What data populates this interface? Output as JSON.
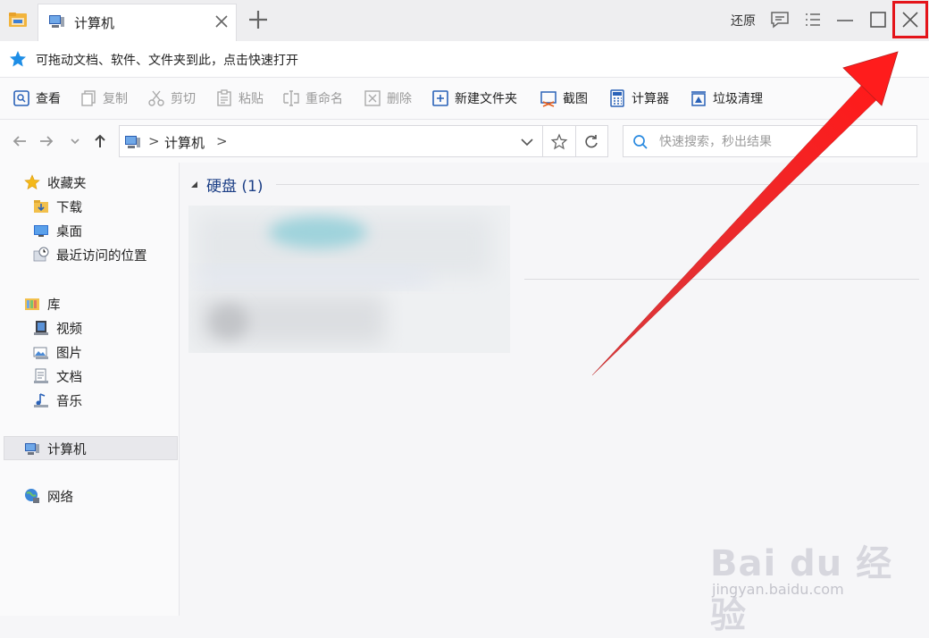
{
  "titlebar": {
    "tab_label": "计算机",
    "restore_label": "还原"
  },
  "favbar": {
    "text": "可拖动文档、软件、文件夹到此，点击快速打开"
  },
  "toolbar": {
    "items": [
      {
        "label": "查看",
        "icon": "view-icon",
        "enabled": true
      },
      {
        "label": "复制",
        "icon": "copy-icon",
        "enabled": false
      },
      {
        "label": "剪切",
        "icon": "scissors-icon",
        "enabled": false
      },
      {
        "label": "粘贴",
        "icon": "paste-icon",
        "enabled": false
      },
      {
        "label": "重命名",
        "icon": "rename-icon",
        "enabled": false
      },
      {
        "label": "删除",
        "icon": "delete-icon",
        "enabled": false
      },
      {
        "label": "新建文件夹",
        "icon": "new-folder-icon",
        "enabled": true
      },
      {
        "label": "截图",
        "icon": "screenshot-icon",
        "enabled": true
      },
      {
        "label": "计算器",
        "icon": "calculator-icon",
        "enabled": true
      },
      {
        "label": "垃圾清理",
        "icon": "cleanup-icon",
        "enabled": true
      }
    ]
  },
  "navbar": {
    "crumb_sep": ">",
    "crumb": "计算机",
    "search_placeholder": "快速搜索，秒出结果"
  },
  "sidebar": {
    "favorites": "收藏夹",
    "downloads": "下载",
    "desktop": "桌面",
    "recent": "最近访问的位置",
    "libraries": "库",
    "videos": "视频",
    "pictures": "图片",
    "documents": "文档",
    "music": "音乐",
    "computer": "计算机",
    "network": "网络"
  },
  "main": {
    "group_title": "硬盘 (1)"
  },
  "watermark": {
    "brand": "Bai du 经验",
    "url": "jingyan.baidu.com"
  },
  "colors": {
    "accent": "#1c3f86",
    "highlight_red": "#e4141a",
    "star_blue": "#1e8ee6"
  }
}
